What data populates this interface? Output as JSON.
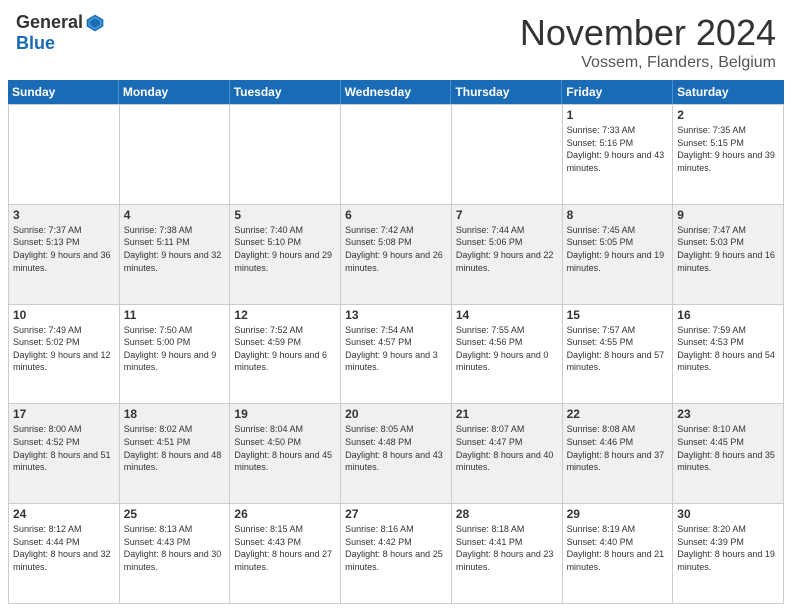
{
  "header": {
    "logo_general": "General",
    "logo_blue": "Blue",
    "month_title": "November 2024",
    "location": "Vossem, Flanders, Belgium"
  },
  "days_of_week": [
    "Sunday",
    "Monday",
    "Tuesday",
    "Wednesday",
    "Thursday",
    "Friday",
    "Saturday"
  ],
  "weeks": [
    [
      {
        "day": "",
        "info": ""
      },
      {
        "day": "",
        "info": ""
      },
      {
        "day": "",
        "info": ""
      },
      {
        "day": "",
        "info": ""
      },
      {
        "day": "",
        "info": ""
      },
      {
        "day": "1",
        "info": "Sunrise: 7:33 AM\nSunset: 5:16 PM\nDaylight: 9 hours and 43 minutes."
      },
      {
        "day": "2",
        "info": "Sunrise: 7:35 AM\nSunset: 5:15 PM\nDaylight: 9 hours and 39 minutes."
      }
    ],
    [
      {
        "day": "3",
        "info": "Sunrise: 7:37 AM\nSunset: 5:13 PM\nDaylight: 9 hours and 36 minutes."
      },
      {
        "day": "4",
        "info": "Sunrise: 7:38 AM\nSunset: 5:11 PM\nDaylight: 9 hours and 32 minutes."
      },
      {
        "day": "5",
        "info": "Sunrise: 7:40 AM\nSunset: 5:10 PM\nDaylight: 9 hours and 29 minutes."
      },
      {
        "day": "6",
        "info": "Sunrise: 7:42 AM\nSunset: 5:08 PM\nDaylight: 9 hours and 26 minutes."
      },
      {
        "day": "7",
        "info": "Sunrise: 7:44 AM\nSunset: 5:06 PM\nDaylight: 9 hours and 22 minutes."
      },
      {
        "day": "8",
        "info": "Sunrise: 7:45 AM\nSunset: 5:05 PM\nDaylight: 9 hours and 19 minutes."
      },
      {
        "day": "9",
        "info": "Sunrise: 7:47 AM\nSunset: 5:03 PM\nDaylight: 9 hours and 16 minutes."
      }
    ],
    [
      {
        "day": "10",
        "info": "Sunrise: 7:49 AM\nSunset: 5:02 PM\nDaylight: 9 hours and 12 minutes."
      },
      {
        "day": "11",
        "info": "Sunrise: 7:50 AM\nSunset: 5:00 PM\nDaylight: 9 hours and 9 minutes."
      },
      {
        "day": "12",
        "info": "Sunrise: 7:52 AM\nSunset: 4:59 PM\nDaylight: 9 hours and 6 minutes."
      },
      {
        "day": "13",
        "info": "Sunrise: 7:54 AM\nSunset: 4:57 PM\nDaylight: 9 hours and 3 minutes."
      },
      {
        "day": "14",
        "info": "Sunrise: 7:55 AM\nSunset: 4:56 PM\nDaylight: 9 hours and 0 minutes."
      },
      {
        "day": "15",
        "info": "Sunrise: 7:57 AM\nSunset: 4:55 PM\nDaylight: 8 hours and 57 minutes."
      },
      {
        "day": "16",
        "info": "Sunrise: 7:59 AM\nSunset: 4:53 PM\nDaylight: 8 hours and 54 minutes."
      }
    ],
    [
      {
        "day": "17",
        "info": "Sunrise: 8:00 AM\nSunset: 4:52 PM\nDaylight: 8 hours and 51 minutes."
      },
      {
        "day": "18",
        "info": "Sunrise: 8:02 AM\nSunset: 4:51 PM\nDaylight: 8 hours and 48 minutes."
      },
      {
        "day": "19",
        "info": "Sunrise: 8:04 AM\nSunset: 4:50 PM\nDaylight: 8 hours and 45 minutes."
      },
      {
        "day": "20",
        "info": "Sunrise: 8:05 AM\nSunset: 4:48 PM\nDaylight: 8 hours and 43 minutes."
      },
      {
        "day": "21",
        "info": "Sunrise: 8:07 AM\nSunset: 4:47 PM\nDaylight: 8 hours and 40 minutes."
      },
      {
        "day": "22",
        "info": "Sunrise: 8:08 AM\nSunset: 4:46 PM\nDaylight: 8 hours and 37 minutes."
      },
      {
        "day": "23",
        "info": "Sunrise: 8:10 AM\nSunset: 4:45 PM\nDaylight: 8 hours and 35 minutes."
      }
    ],
    [
      {
        "day": "24",
        "info": "Sunrise: 8:12 AM\nSunset: 4:44 PM\nDaylight: 8 hours and 32 minutes."
      },
      {
        "day": "25",
        "info": "Sunrise: 8:13 AM\nSunset: 4:43 PM\nDaylight: 8 hours and 30 minutes."
      },
      {
        "day": "26",
        "info": "Sunrise: 8:15 AM\nSunset: 4:43 PM\nDaylight: 8 hours and 27 minutes."
      },
      {
        "day": "27",
        "info": "Sunrise: 8:16 AM\nSunset: 4:42 PM\nDaylight: 8 hours and 25 minutes."
      },
      {
        "day": "28",
        "info": "Sunrise: 8:18 AM\nSunset: 4:41 PM\nDaylight: 8 hours and 23 minutes."
      },
      {
        "day": "29",
        "info": "Sunrise: 8:19 AM\nSunset: 4:40 PM\nDaylight: 8 hours and 21 minutes."
      },
      {
        "day": "30",
        "info": "Sunrise: 8:20 AM\nSunset: 4:39 PM\nDaylight: 8 hours and 19 minutes."
      }
    ]
  ]
}
